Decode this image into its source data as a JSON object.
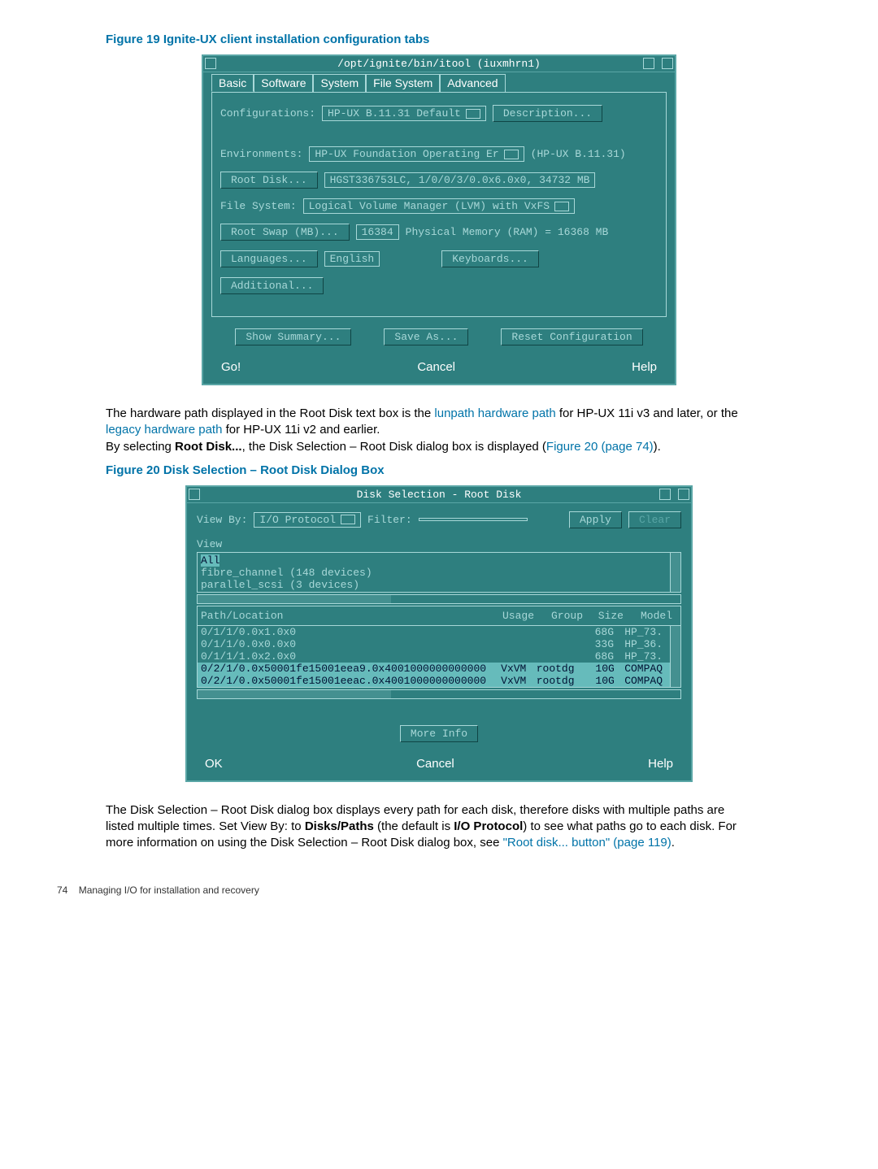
{
  "figure19": {
    "caption": "Figure 19 Ignite-UX client installation configuration tabs",
    "title": "/opt/ignite/bin/itool (iuxmhrn1)",
    "tabs": [
      "Basic",
      "Software",
      "System",
      "File System",
      "Advanced"
    ],
    "configurations_label": "Configurations:",
    "configurations_value": "HP-UX B.11.31 Default",
    "description_btn": "Description...",
    "environments_label": "Environments:",
    "environments_value": "HP-UX Foundation Operating Er",
    "environments_suffix": "(HP-UX B.11.31)",
    "root_disk_btn": "Root Disk...",
    "root_disk_value": "HGST336753LC, 1/0/0/3/0.0x6.0x0, 34732 MB",
    "filesystem_label": "File System:",
    "filesystem_value": "Logical Volume Manager (LVM) with VxFS",
    "root_swap_btn": "Root Swap (MB)...",
    "root_swap_value": "16384",
    "physical_memory": "Physical Memory (RAM) =  16368 MB",
    "languages_btn": "Languages...",
    "languages_value": "English",
    "keyboards_btn": "Keyboards...",
    "additional_btn": "Additional...",
    "show_summary_btn": "Show Summary...",
    "save_as_btn": "Save As...",
    "reset_btn": "Reset Configuration",
    "go_btn": "Go!",
    "cancel_btn": "Cancel",
    "help_btn": "Help"
  },
  "text1": {
    "p1a": "The hardware path displayed in the Root Disk text box is the ",
    "p1link1": "lunpath hardware path",
    "p1b": " for HP-UX 11i v3 and later, or the ",
    "p1link2": "legacy hardware path",
    "p1c": " for HP-UX 11i v2 and earlier.",
    "p2a": "By selecting ",
    "p2b": "Root Disk...",
    "p2c": ", the Disk Selection – Root Disk dialog box is displayed (",
    "p2link": "Figure 20 (page 74)",
    "p2d": ")."
  },
  "figure20": {
    "caption": "Figure 20 Disk Selection – Root Disk Dialog Box",
    "title": "Disk Selection - Root Disk",
    "view_by_label": "View By:",
    "view_by_value": "I/O Protocol",
    "filter_label": "Filter:",
    "filter_value": "",
    "apply_btn": "Apply",
    "clear_btn": "Clear",
    "view_label": "View",
    "tree": [
      "All",
      "fibre_channel  (148 devices)",
      "parallel_scsi  (3 devices)"
    ],
    "cols": {
      "path": "Path/Location",
      "usage": "Usage",
      "group": "Group",
      "size": "Size",
      "model": "Model"
    },
    "rows": [
      {
        "path": "0/1/1/0.0x1.0x0",
        "usage": "",
        "group": "",
        "size": "68G",
        "model": "HP_73."
      },
      {
        "path": "0/1/1/0.0x0.0x0",
        "usage": "",
        "group": "",
        "size": "33G",
        "model": "HP_36."
      },
      {
        "path": "0/1/1/1.0x2.0x0",
        "usage": "",
        "group": "",
        "size": "68G",
        "model": "HP_73."
      },
      {
        "path": "0/2/1/0.0x50001fe15001eea9.0x4001000000000000",
        "usage": "VxVM",
        "group": "rootdg",
        "size": "10G",
        "model": "COMPAQ",
        "sel": true
      },
      {
        "path": "0/2/1/0.0x50001fe15001eeac.0x4001000000000000",
        "usage": "VxVM",
        "group": "rootdg",
        "size": "10G",
        "model": "COMPAQ",
        "sel": true
      }
    ],
    "more_info_btn": "More Info",
    "ok_btn": "OK",
    "cancel_btn": "Cancel",
    "help_btn": "Help"
  },
  "text2": {
    "p1a": "The Disk Selection – Root Disk dialog box displays every path for each disk, therefore disks with multiple paths are listed multiple times. Set View By: to ",
    "p1b": "Disks/Paths",
    "p1c": " (the default is ",
    "p1d": "I/O Protocol",
    "p1e": ") to see what paths go to each disk. For more information on using the Disk Selection – Root Disk dialog box, see ",
    "p1link": "\"Root disk... button\" (page 119)",
    "p1f": "."
  },
  "footer": {
    "page": "74",
    "section": "Managing I/O for installation and recovery"
  }
}
